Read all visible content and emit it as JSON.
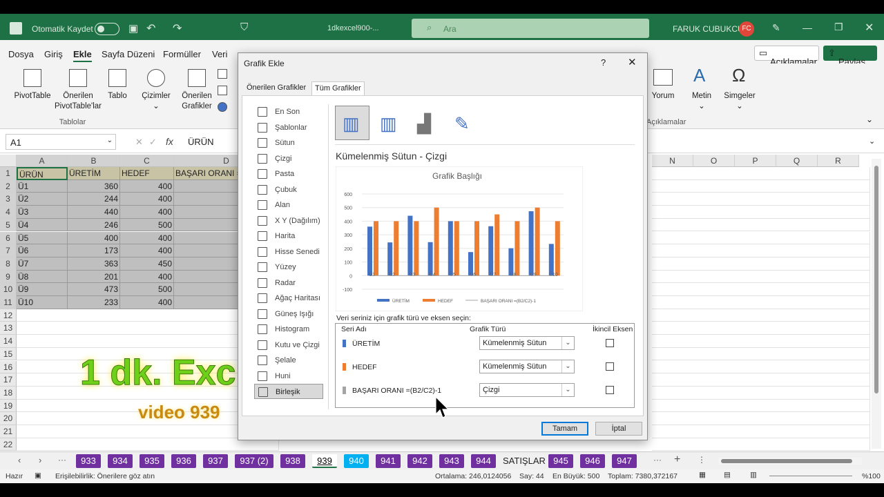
{
  "app": {
    "autosave": "Otomatik Kaydet",
    "filename": "1dkexcel900-...",
    "search": "Ara",
    "user": "FARUK CUBUKCU",
    "initials": "FC"
  },
  "menu": {
    "items": [
      "Dosya",
      "Giriş",
      "Ekle",
      "Sayfa Düzeni",
      "Formüller",
      "Veri"
    ],
    "active": "Ekle",
    "comments": "Açıklamalar",
    "share": "Paylaş"
  },
  "ribbon": {
    "pivot": "PivotTable",
    "recpivot1": "Önerilen",
    "recpivot2": "PivotTable'lar",
    "table": "Tablo",
    "group": "Tablolar",
    "drawing": "Çizimler",
    "reccharts1": "Önerilen",
    "reccharts2": "Grafikler",
    "comment": "Yorum",
    "comments_group": "Açıklamalar",
    "text": "Metin",
    "symbols": "Simgeler"
  },
  "formula": {
    "namebox": "A1",
    "fx": "fx",
    "value": "ÜRÜN"
  },
  "columns": [
    "A",
    "B",
    "C",
    "D",
    "N",
    "O",
    "P",
    "Q",
    "R"
  ],
  "table": {
    "headers": [
      "ÜRÜN",
      "ÜRETİM",
      "HEDEF",
      "BAŞARI ORANI ="
    ],
    "rows": [
      [
        "Ü1",
        "360",
        "400"
      ],
      [
        "Ü2",
        "244",
        "400"
      ],
      [
        "Ü3",
        "440",
        "400"
      ],
      [
        "Ü4",
        "246",
        "500"
      ],
      [
        "Ü5",
        "400",
        "400"
      ],
      [
        "Ü6",
        "173",
        "400"
      ],
      [
        "Ü7",
        "363",
        "450"
      ],
      [
        "Ü8",
        "201",
        "400"
      ],
      [
        "Ü9",
        "473",
        "500"
      ],
      [
        "Ü10",
        "233",
        "400"
      ]
    ]
  },
  "rownums": [
    "1",
    "2",
    "3",
    "4",
    "5",
    "6",
    "7",
    "8",
    "9",
    "10",
    "11",
    "12",
    "13",
    "14",
    "15",
    "16",
    "17",
    "18",
    "19",
    "20",
    "21",
    "22"
  ],
  "watermark": {
    "line1": "1 dk. Exc",
    "line2": "video 939"
  },
  "dialog": {
    "title": "Grafik Ekle",
    "help": "?",
    "tab1": "Önerilen Grafikler",
    "tab2": "Tüm Grafikler",
    "types": [
      "En Son",
      "Şablonlar",
      "Sütun",
      "Çizgi",
      "Pasta",
      "Çubuk",
      "Alan",
      "X Y (Dağılım)",
      "Harita",
      "Hisse Senedi",
      "Yüzey",
      "Radar",
      "Ağaç Haritası",
      "Güneş Işığı",
      "Histogram",
      "Kutu ve Çizgi",
      "Şelale",
      "Huni",
      "Birleşik"
    ],
    "selected_type": "Birleşik",
    "subtitle": "Kümelenmiş Sütun - Çizgi",
    "series_prompt": "Veri seriniz için grafik türü ve eksen seçin:",
    "col_series": "Seri Adı",
    "col_type": "Grafik Türü",
    "col_secondary": "İkincil Eksen",
    "series": [
      {
        "name": "ÜRETİM",
        "type": "Kümelenmiş Sütun",
        "color": "#4472c4"
      },
      {
        "name": "HEDEF",
        "type": "Kümelenmiş Sütun",
        "color": "#ed7d31"
      },
      {
        "name": "BAŞARI ORANI =(B2/C2)-1",
        "type": "Çizgi",
        "color": "#a5a5a5"
      }
    ],
    "ok": "Tamam",
    "cancel": "İptal"
  },
  "chart_data": {
    "type": "bar",
    "title": "Grafik Başlığı",
    "categories": [
      "Ü1",
      "Ü2",
      "Ü3",
      "Ü4",
      "Ü5",
      "Ü6",
      "Ü7",
      "Ü8",
      "Ü9",
      "Ü10"
    ],
    "series": [
      {
        "name": "ÜRETİM",
        "values": [
          360,
          244,
          440,
          246,
          400,
          173,
          363,
          201,
          473,
          233
        ],
        "color": "#4472c4"
      },
      {
        "name": "HEDEF",
        "values": [
          400,
          400,
          400,
          500,
          400,
          400,
          450,
          400,
          500,
          400
        ],
        "color": "#ed7d31"
      },
      {
        "name": "BAŞARI ORANI =(B2/C2)-1",
        "values": [
          -0.1,
          -0.39,
          0.1,
          -0.508,
          0,
          -0.5675,
          -0.1933,
          -0.4975,
          -0.054,
          -0.4175
        ],
        "color": "#a5a5a5"
      }
    ],
    "yticks": [
      "600",
      "500",
      "400",
      "300",
      "200",
      "100",
      "0",
      "-100"
    ],
    "ylim": [
      -100,
      600
    ]
  },
  "sheets": {
    "tabs": [
      "933",
      "934",
      "935",
      "936",
      "937",
      "937 (2)",
      "938",
      "939",
      "940",
      "941",
      "942",
      "943",
      "944",
      "SATIŞLAR",
      "945",
      "946",
      "947"
    ],
    "active": "939"
  },
  "status": {
    "ready": "Hazır",
    "access": "Erişilebilirlik: Önerilere göz atın",
    "avg": "Ortalama: 246,0124056",
    "count": "Say: 44",
    "max": "En Büyük: 500",
    "sum": "Toplam: 7380,372167",
    "zoom": "%100"
  }
}
